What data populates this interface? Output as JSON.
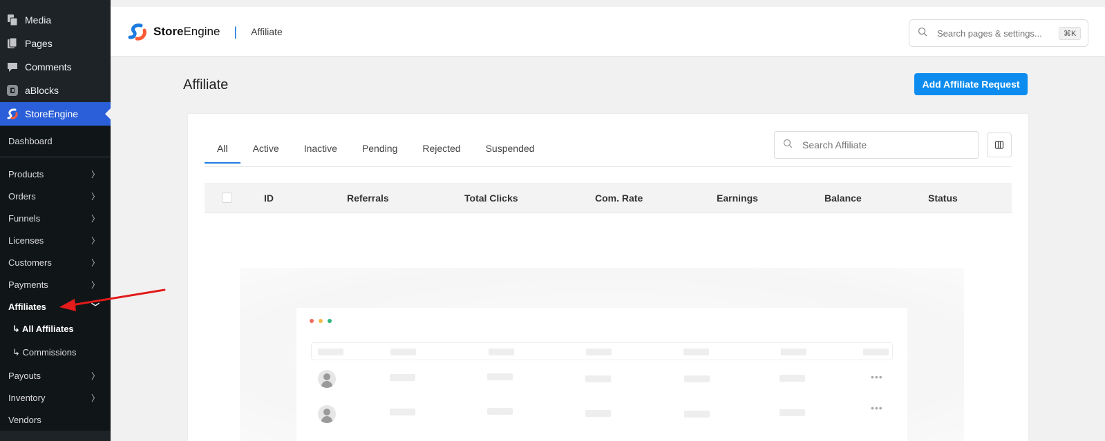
{
  "sidebar": {
    "top_items": [
      {
        "label": "Media",
        "icon": "media-icon"
      },
      {
        "label": "Pages",
        "icon": "pages-icon"
      },
      {
        "label": "Comments",
        "icon": "comments-icon"
      },
      {
        "label": "aBlocks",
        "icon": "ablocks-icon"
      },
      {
        "label": "StoreEngine",
        "icon": "storeengine-icon"
      }
    ],
    "dashboard": "Dashboard",
    "menu": [
      {
        "label": "Products"
      },
      {
        "label": "Orders"
      },
      {
        "label": "Funnels"
      },
      {
        "label": "Licenses"
      },
      {
        "label": "Customers"
      },
      {
        "label": "Payments"
      }
    ],
    "affiliates": "Affiliates",
    "affiliates_children": [
      "↳ All Affiliates",
      "↳ Commissions"
    ],
    "menu_after": [
      {
        "label": "Payouts"
      },
      {
        "label": "Inventory"
      },
      {
        "label": "Vendors"
      }
    ]
  },
  "header": {
    "brand_bold": "Store",
    "brand_rest": "Engine",
    "separator": "|",
    "page": "Affiliate",
    "search_placeholder": "Search pages & settings...",
    "shortcut": "⌘K"
  },
  "page": {
    "title": "Affiliate",
    "add_button": "Add Affiliate Request"
  },
  "tabs": [
    "All",
    "Active",
    "Inactive",
    "Pending",
    "Rejected",
    "Suspended"
  ],
  "active_tab": "All",
  "affiliate_search_placeholder": "Search Affiliate",
  "table": {
    "columns": [
      "ID",
      "Referrals",
      "Total Clicks",
      "Com. Rate",
      "Earnings",
      "Balance",
      "Status"
    ]
  },
  "colors": {
    "accent": "#0d8cf0",
    "sidebar_bg": "#1d2327",
    "sidebar_active": "#2b5fd9",
    "annotation_arrow": "#e21b1b",
    "dot_red": "#f26b5b",
    "dot_yellow": "#f5b94d",
    "dot_green": "#2bb57d"
  }
}
